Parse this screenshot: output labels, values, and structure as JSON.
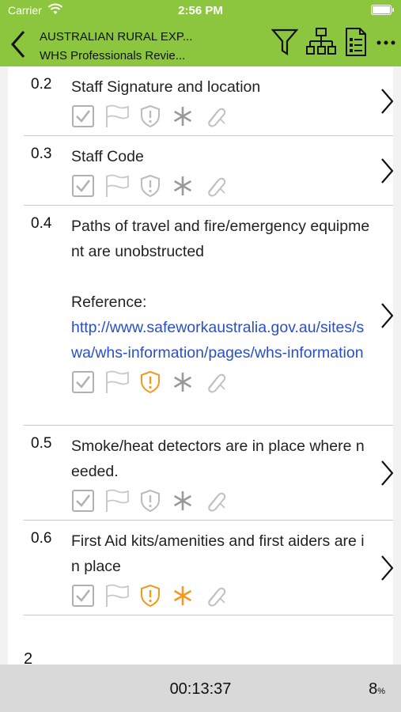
{
  "status": {
    "carrier": "Carrier",
    "time": "2:56 PM"
  },
  "nav": {
    "title": "AUSTRALIAN RURAL EXP...",
    "subtitle": "WHS Professionals Revie..."
  },
  "items": [
    {
      "num": "0.2",
      "text": "Staff Signature and location",
      "warn_active": false,
      "star_active": false
    },
    {
      "num": "0.3",
      "text": "Staff Code",
      "warn_active": false,
      "star_active": false
    },
    {
      "num": "0.4",
      "text": "Paths of travel and fire/emergency equipment are unobstructed",
      "ref_label": "Reference:",
      "link": "http://www.safeworkaustralia.gov.au/sites/swa/whs-information/pages/whs-information",
      "warn_active": true,
      "star_active": false
    },
    {
      "num": "0.5",
      "text": "Smoke/heat detectors are in place where needed.",
      "warn_active": false,
      "star_active": false
    },
    {
      "num": "0.6",
      "text": "First Aid kits/amenities and first aiders are in place",
      "warn_active": true,
      "star_active": true
    }
  ],
  "section_next": "2",
  "footer": {
    "timer": "00:13:37",
    "percent": "8",
    "percent_unit": "%"
  },
  "colors": {
    "header": "#8cc63f",
    "link": "#2a4fc7",
    "active_orange": "#f39a1e",
    "inactive_grey": "#b0b0b0"
  }
}
